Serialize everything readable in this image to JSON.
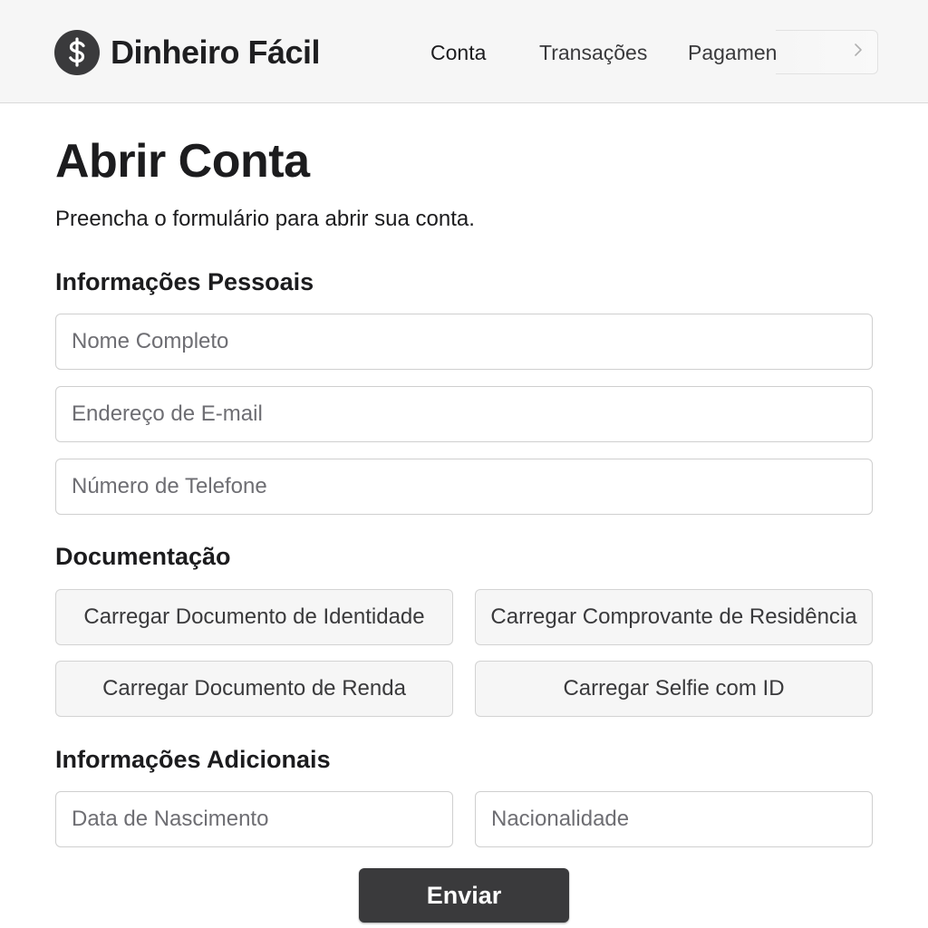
{
  "brand": {
    "name": "Dinheiro Fácil",
    "icon": "dollar-icon",
    "icon_color": "#3a3a3c"
  },
  "nav": {
    "items": [
      {
        "label": "Conta",
        "active": true
      },
      {
        "label": "Transações",
        "active": false
      },
      {
        "label": "Pagamentos",
        "active": false
      }
    ],
    "more_icon": "chevron-right-icon"
  },
  "page": {
    "title": "Abrir Conta",
    "subtitle": "Preencha o formulário para abrir sua conta."
  },
  "personal": {
    "heading": "Informações Pessoais",
    "fields": [
      {
        "placeholder": "Nome Completo",
        "value": ""
      },
      {
        "placeholder": "Endereço de E-mail",
        "value": ""
      },
      {
        "placeholder": "Número de Telefone",
        "value": ""
      }
    ]
  },
  "documents": {
    "heading": "Documentação",
    "buttons": [
      {
        "label": "Carregar Documento de Identidade"
      },
      {
        "label": "Carregar Comprovante de Residência"
      },
      {
        "label": "Carregar Documento de Renda"
      },
      {
        "label": "Carregar Selfie com ID"
      }
    ]
  },
  "additional": {
    "heading": "Informações Adicionais",
    "fields": [
      {
        "placeholder": "Data de Nascimento",
        "value": ""
      },
      {
        "placeholder": "Nacionalidade",
        "value": ""
      }
    ]
  },
  "submit": {
    "label": "Enviar",
    "color": "#3a3a3c"
  }
}
